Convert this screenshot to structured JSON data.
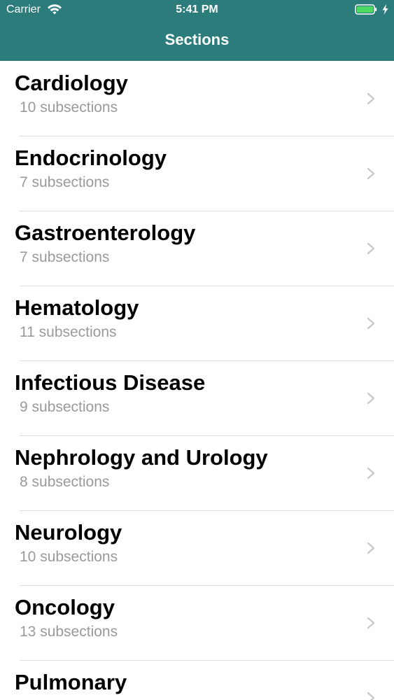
{
  "status_bar": {
    "carrier": "Carrier",
    "time": "5:41 PM",
    "icons": [
      "wifi-icon",
      "battery-icon",
      "charging-bolt-icon"
    ]
  },
  "nav": {
    "title": "Sections"
  },
  "sections": [
    {
      "title": "Cardiology",
      "subtitle": "10 subsections"
    },
    {
      "title": "Endocrinology",
      "subtitle": "7 subsections"
    },
    {
      "title": "Gastroenterology",
      "subtitle": "7 subsections"
    },
    {
      "title": "Hematology",
      "subtitle": "11 subsections"
    },
    {
      "title": "Infectious Disease",
      "subtitle": "9 subsections"
    },
    {
      "title": "Nephrology and Urology",
      "subtitle": "8 subsections"
    },
    {
      "title": "Neurology",
      "subtitle": "10 subsections"
    },
    {
      "title": "Oncology",
      "subtitle": "13 subsections"
    },
    {
      "title": "Pulmonary",
      "subtitle": ""
    }
  ],
  "colors": {
    "header_background": "#2c7c7c",
    "header_text": "#ffffff",
    "title_text": "#000000",
    "subtitle_text": "#9a9a9a",
    "separator": "#dedede",
    "chevron": "#c7c7cc",
    "battery_fill": "#4cd964"
  }
}
